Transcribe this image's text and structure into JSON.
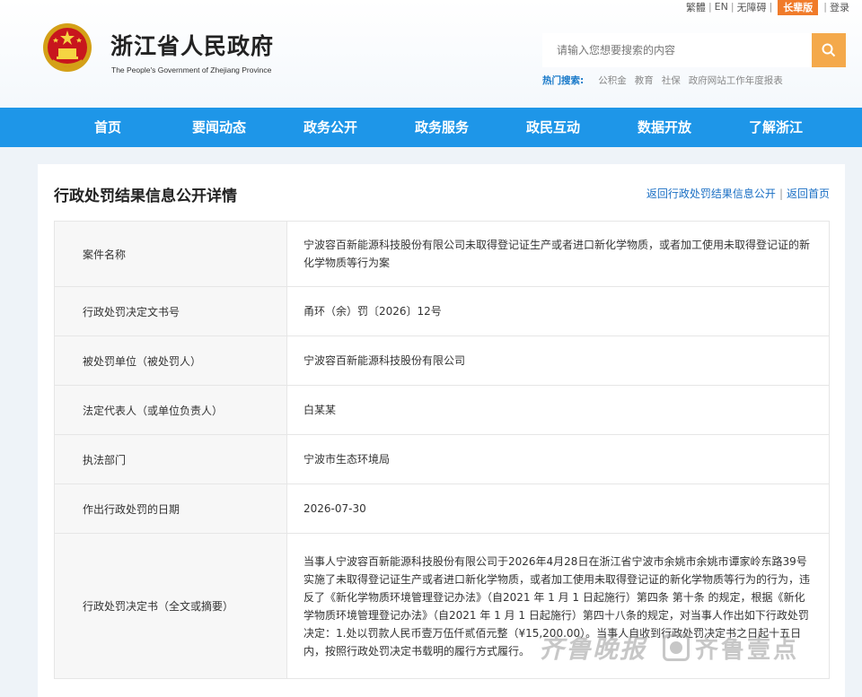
{
  "topbar": {
    "traditional": "繁體",
    "english": "EN",
    "accessibility": "无障碍",
    "elder_mode": "长辈版",
    "login": "登录"
  },
  "site": {
    "title": "浙江省人民政府",
    "subtitle": "The People's Government of Zhejiang Province"
  },
  "search": {
    "placeholder": "请输入您想要搜索的内容",
    "hot_label": "热门搜索:",
    "hot_terms": [
      "公积金",
      "教育",
      "社保",
      "政府网站工作年度报表"
    ]
  },
  "nav": [
    "首页",
    "要闻动态",
    "政务公开",
    "政务服务",
    "政民互动",
    "数据开放",
    "了解浙江"
  ],
  "page": {
    "title": "行政处罚结果信息公开详情",
    "back_link": "返回行政处罚结果信息公开",
    "home_link": "返回首页"
  },
  "rows": [
    {
      "key": "案件名称",
      "value": "宁波容百新能源科技股份有限公司未取得登记证生产或者进口新化学物质，或者加工使用未取得登记证的新化学物质等行为案"
    },
    {
      "key": "行政处罚决定文书号",
      "value": "甬环（余）罚〔2026〕12号"
    },
    {
      "key": "被处罚单位（被处罚人）",
      "value": "宁波容百新能源科技股份有限公司"
    },
    {
      "key": "法定代表人（或单位负责人）",
      "value": "白某某"
    },
    {
      "key": "执法部门",
      "value": "宁波市生态环境局"
    },
    {
      "key": "作出行政处罚的日期",
      "value": "2026-07-30"
    },
    {
      "key": "行政处罚决定书（全文或摘要）",
      "value": "当事人宁波容百新能源科技股份有限公司于2026年4月28日在浙江省宁波市余姚市余姚市谭家岭东路39号实施了未取得登记证生产或者进口新化学物质，或者加工使用未取得登记证的新化学物质等行为的行为，违反了《新化学物质环境管理登记办法》（自2021 年 1 月 1 日起施行）第四条 第十条 的规定，根据《新化学物质环境管理登记办法》（自2021 年 1 月 1 日起施行）第四十八条的规定，对当事人作出如下行政处罚决定：1.处以罚款人民币壹万伍仟贰佰元整（¥15,200.00）。当事人自收到行政处罚决定书之日起十五日内，按照行政处罚决定书载明的履行方式履行。"
    }
  ],
  "watermark": {
    "text1": "齐鲁晚报",
    "text2": "齐鲁壹点"
  },
  "colors": {
    "nav_bg": "#1e96e8",
    "search_button": "#f4a94b",
    "elder_badge": "#f07b2a",
    "link": "#1a6fc4"
  }
}
